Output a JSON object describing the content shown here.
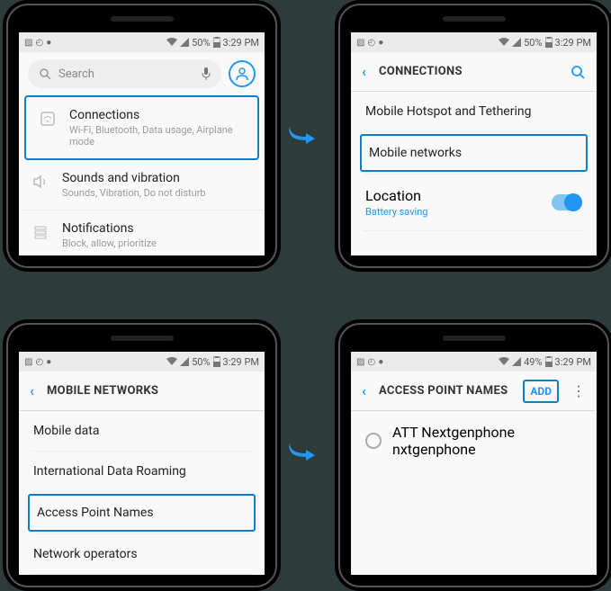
{
  "status": {
    "battery50": "50%",
    "battery49": "49%",
    "time": "3:29 PM"
  },
  "phone1": {
    "search_placeholder": "Search",
    "items": {
      "connections": {
        "title": "Connections",
        "sub": "Wi-Fi, Bluetooth, Data usage, Airplane mode"
      },
      "sounds": {
        "title": "Sounds and vibration",
        "sub": "Sounds, Vibration, Do not disturb"
      },
      "notifications": {
        "title": "Notifications",
        "sub": "Block, allow, prioritize"
      }
    }
  },
  "phone2": {
    "title": "CONNECTIONS",
    "items": {
      "hotspot": "Mobile Hotspot and Tethering",
      "mobile_networks": "Mobile networks",
      "location": {
        "title": "Location",
        "sub": "Battery saving"
      }
    }
  },
  "phone3": {
    "title": "MOBILE NETWORKS",
    "items": {
      "mobile_data": "Mobile data",
      "roaming": "International Data Roaming",
      "apn": "Access Point Names",
      "operators": "Network operators"
    }
  },
  "phone4": {
    "title": "ACCESS POINT NAMES",
    "add": "ADD",
    "apn": {
      "name": "ATT Nextgenphone",
      "apn_value": "nxtgenphone"
    }
  }
}
